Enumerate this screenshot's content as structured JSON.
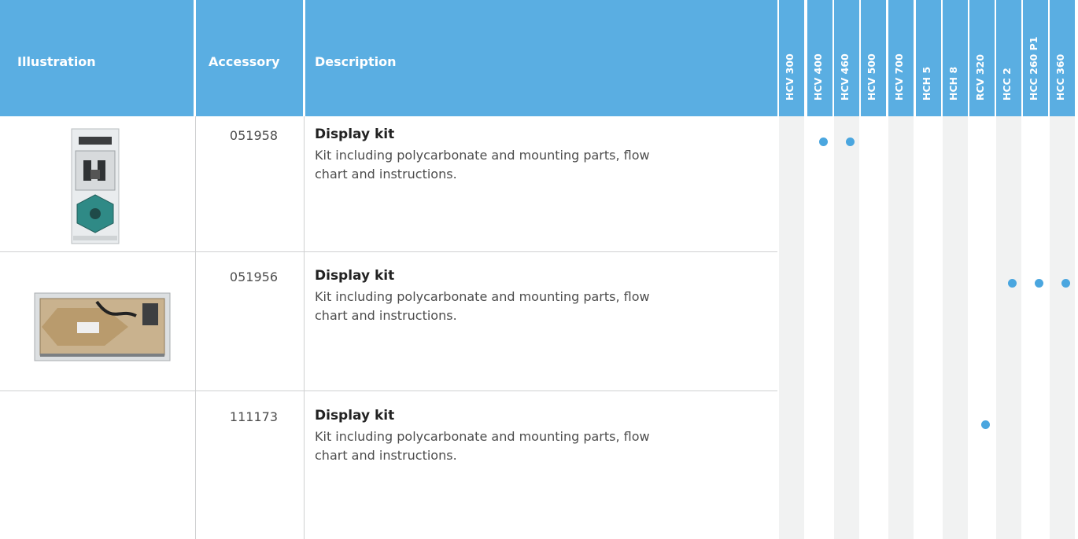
{
  "header": {
    "illustration": "Illustration",
    "accessory": "Accessory",
    "description": "Description",
    "models": [
      "HCV 300",
      "HCV 400",
      "HCV 460",
      "HCV 500",
      "HCV 700",
      "HCH 5",
      "HCH 8",
      "RCV 320",
      "HCC 2",
      "HCC 260 P1",
      "HCC 360"
    ]
  },
  "rows": [
    {
      "accessory": "051958",
      "title": "Display kit",
      "text": "Kit including polycarbonate and mounting parts, flow chart and instructions.",
      "compatible": [
        "HCV 400",
        "HCV 460"
      ]
    },
    {
      "accessory": "051956",
      "title": "Display kit",
      "text": "Kit including polycarbonate and mounting parts, flow chart and instructions.",
      "compatible": [
        "HCC 2",
        "HCC 260 P1",
        "HCC 360"
      ]
    },
    {
      "accessory": "111173",
      "title": "Display kit",
      "text": "Kit including polycarbonate and mounting parts, flow chart and instructions.",
      "compatible": [
        "RCV 320"
      ]
    }
  ],
  "colors": {
    "header": "#5aaee2",
    "dot": "#4aa6df",
    "band": "#f1f2f2"
  }
}
